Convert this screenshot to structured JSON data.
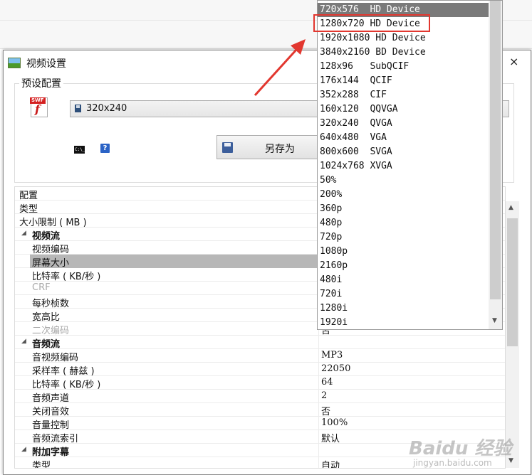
{
  "window": {
    "title": "视频设置",
    "close_glyph": "×"
  },
  "preset": {
    "group_label": "预设配置",
    "selected": "320x240",
    "saveas_label": "另存为",
    "cmd_icon_text": "C:\\_",
    "help_icon_text": "?"
  },
  "properties": [
    {
      "label": "配置",
      "value": "",
      "level": 0
    },
    {
      "label": "类型",
      "value": "",
      "level": 0
    },
    {
      "label": "大小限制 ( MB )",
      "value": "",
      "level": 0
    },
    {
      "label": "视频流",
      "value": "",
      "level": "cat"
    },
    {
      "label": "视频编码",
      "value": "",
      "level": 1
    },
    {
      "label": "屏幕大小",
      "value": "",
      "level": 1,
      "selected": true
    },
    {
      "label": "比特率 ( KB/秒 )",
      "value": "",
      "level": 1
    },
    {
      "label": "CRF",
      "value": "",
      "level": 1,
      "dim": true
    },
    {
      "label": "每秒桢数",
      "value": "",
      "level": 1
    },
    {
      "label": "宽高比",
      "value": "",
      "level": 1
    },
    {
      "label": "二次编码",
      "value": "否",
      "level": 1,
      "dim": true
    },
    {
      "label": "音频流",
      "value": "",
      "level": "cat"
    },
    {
      "label": "音视频编码",
      "value": "MP3",
      "level": 1
    },
    {
      "label": "采样率 ( 赫兹 )",
      "value": "22050",
      "level": 1
    },
    {
      "label": "比特率 ( KB/秒 )",
      "value": "64",
      "level": 1
    },
    {
      "label": "音频声道",
      "value": "2",
      "level": 1
    },
    {
      "label": "关闭音效",
      "value": "否",
      "level": 1
    },
    {
      "label": "音量控制",
      "value": "100%",
      "level": 1
    },
    {
      "label": "音频流索引",
      "value": "默认",
      "level": 1
    },
    {
      "label": "附加字幕",
      "value": "",
      "level": "cat"
    },
    {
      "label": "类型",
      "value": "自动",
      "level": 1
    }
  ],
  "dropdown_options": [
    "720x576  HD Device",
    "1280x720 HD Device",
    "1920x1080 HD Device",
    "3840x2160 BD Device",
    "128x96   SubQCIF",
    "176x144  QCIF",
    "352x288  CIF",
    "160x120  QQVGA",
    "320x240  QVGA",
    "640x480  VGA",
    "800x600  SVGA",
    "1024x768 XVGA",
    "50%",
    "200%",
    "360p",
    "480p",
    "720p",
    "1080p",
    "2160p",
    "480i",
    "720i",
    "1280i",
    "1920i"
  ],
  "dropdown_highlighted_index": 0,
  "annotation": {
    "color": "#e2372f",
    "boxed_index": 1
  },
  "watermark": {
    "brand": "Baidu 经验",
    "site": "jingyan.baidu.com"
  }
}
